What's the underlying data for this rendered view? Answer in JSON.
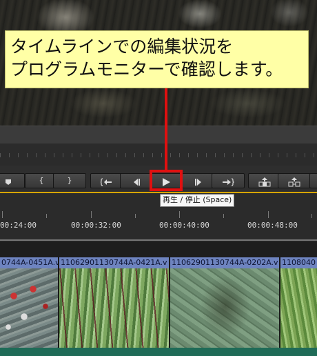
{
  "callout": {
    "line1": "タイムラインでの編集状況を",
    "line2": "プログラムモニターで確認します。"
  },
  "controls": {
    "buttons": [
      {
        "name": "add-marker-button",
        "icon": "marker-icon"
      },
      {
        "name": "mark-in-button",
        "icon": "in-bracket-icon",
        "label": "{"
      },
      {
        "name": "mark-out-button",
        "icon": "out-bracket-icon",
        "label": "}"
      },
      {
        "name": "go-to-in-button",
        "icon": "go-to-in-icon"
      },
      {
        "name": "step-back-button",
        "icon": "step-back-icon"
      },
      {
        "name": "play-stop-button",
        "icon": "play-icon"
      },
      {
        "name": "step-forward-button",
        "icon": "step-forward-icon"
      },
      {
        "name": "go-to-out-button",
        "icon": "go-to-out-icon"
      },
      {
        "name": "lift-button",
        "icon": "lift-icon"
      },
      {
        "name": "extract-button",
        "icon": "extract-icon"
      }
    ],
    "tooltip": "再生 / 停止 (Space)"
  },
  "timeline": {
    "timecodes": [
      "00:24:00",
      "00:00:32:00",
      "00:00:40:00",
      "00:00:48:00"
    ],
    "clips": [
      "0744A-0451A.v",
      "11062901130744A-0421A.v",
      "11062901130744A-0202A.v",
      "1108040"
    ]
  },
  "colors": {
    "highlight": "#e01010",
    "callout_bg": "#ffffa6",
    "clip_header": "#6e84c0",
    "work_area": "#d7a500"
  }
}
